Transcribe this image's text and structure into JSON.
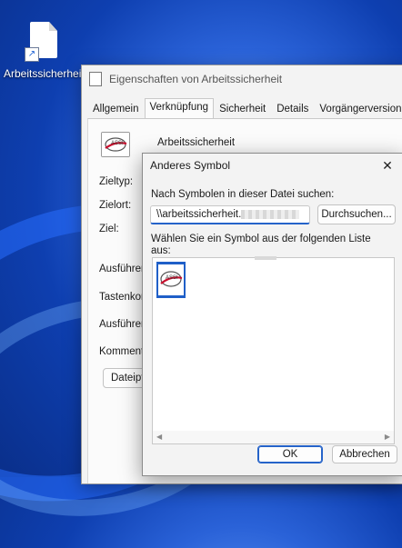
{
  "desktop": {
    "file_label": "Arbeitssicherheit"
  },
  "properties_window": {
    "title": "Eigenschaften von Arbeitssicherheit",
    "tabs": [
      "Allgemein",
      "Verknüpfung",
      "Sicherheit",
      "Details",
      "Vorgängerversionen"
    ],
    "active_tab": "Verknüpfung",
    "file_name": "Arbeitssicherheit",
    "labels": {
      "zieltyp": "Zieltyp:",
      "zielort": "Zielort:",
      "ziel": "Ziel:",
      "ausfuehren_in": "Ausführen",
      "tastenkombination": "Tastenkor",
      "ausfuehren": "Ausführen",
      "kommentar": "Kommenta"
    },
    "open_file_location_button": "Dateipf"
  },
  "change_icon_dialog": {
    "title": "Anderes Symbol",
    "search_label": "Nach Symbolen in dieser Datei suchen:",
    "path_value": "\\\\arbeitssicherheit.",
    "browse_button": "Durchsuchen...",
    "list_label": "Wählen Sie ein Symbol aus der folgenden Liste aus:",
    "ok_button": "OK",
    "cancel_button": "Abbrechen",
    "logo_text": "ASSI",
    "colors": {
      "accent": "#2563c9",
      "selection": "#1f5fc8",
      "logo_red": "#c8102e"
    }
  }
}
